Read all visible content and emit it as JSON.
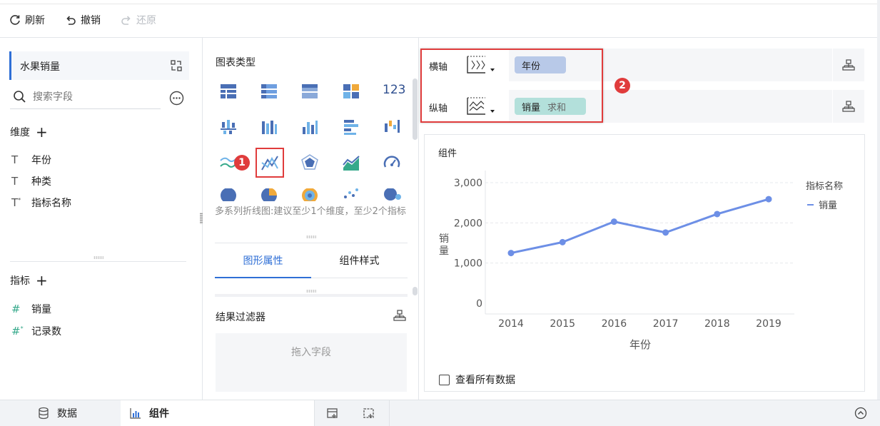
{
  "toolbar": {
    "refresh": "刷新",
    "undo": "撤销",
    "redo": "还原"
  },
  "left": {
    "dataset": "水果销量",
    "search_placeholder": "搜索字段",
    "dimension_title": "维度",
    "dimensions": [
      {
        "icon": "text-field-icon",
        "label": "年份"
      },
      {
        "icon": "text-field-icon",
        "label": "种类"
      },
      {
        "icon": "text-field-star-icon",
        "label": "指标名称"
      }
    ],
    "metric_title": "指标",
    "metrics": [
      {
        "icon": "number-field-icon",
        "label": "销量"
      },
      {
        "icon": "number-field-star-icon",
        "label": "记录数"
      }
    ]
  },
  "middle": {
    "chart_type_title": "图表类型",
    "hint": "多系列折线图:建议至少1个维度，至少2个指标",
    "tabs": [
      "图形属性",
      "组件样式"
    ],
    "result_filter_title": "结果过滤器",
    "drop_field": "拖入字段",
    "badge1": "1"
  },
  "axes": {
    "x_label": "横轴",
    "x_field": "年份",
    "y_label": "纵轴",
    "y_field": "销量",
    "y_agg": "求和",
    "badge2": "2"
  },
  "chart": {
    "card_title": "组件",
    "view_all": "查看所有数据",
    "color": "#6d8fe6"
  },
  "chart_data": {
    "type": "line",
    "xlabel": "年份",
    "ylabel": "销量",
    "legend_title": "指标名称",
    "legend_position": "right",
    "grid": true,
    "categories": [
      "2014",
      "2015",
      "2016",
      "2017",
      "2018",
      "2019"
    ],
    "series": [
      {
        "name": "销量",
        "values": [
          1250,
          1520,
          2030,
          1760,
          2220,
          2590
        ]
      }
    ],
    "yticks": [
      "3,000",
      "2,000",
      "1,000",
      "0"
    ],
    "ytick_values": [
      3000,
      2000,
      1000,
      0
    ],
    "ylim": [
      0,
      3000
    ]
  },
  "bottom": {
    "data_tab": "数据",
    "component_tab": "组件"
  }
}
